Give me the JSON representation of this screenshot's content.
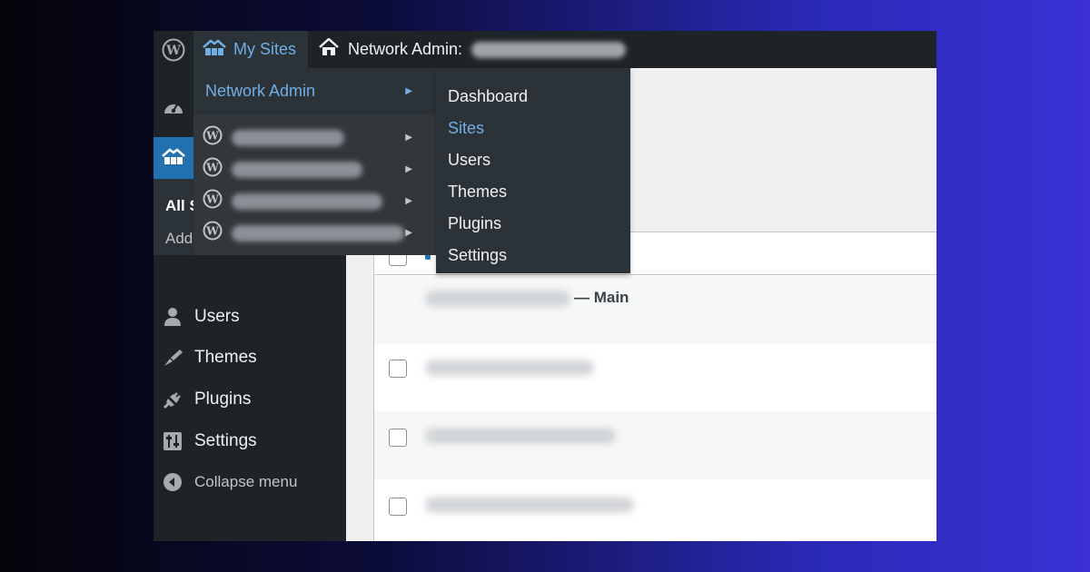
{
  "adminbar": {
    "my_sites_label": "My Sites",
    "network_admin_label": "Network Admin:"
  },
  "sidebar": {
    "submenu": [
      "All S",
      "Add"
    ],
    "items": [
      {
        "label": "Users",
        "icon": "user-icon"
      },
      {
        "label": "Themes",
        "icon": "brush-icon"
      },
      {
        "label": "Plugins",
        "icon": "plug-icon"
      },
      {
        "label": "Settings",
        "icon": "settings-icon"
      },
      {
        "label": "Collapse menu",
        "icon": "collapse-icon"
      }
    ]
  },
  "mysites_menu": {
    "network_admin": "Network Admin",
    "site_count": 4
  },
  "network_submenu": {
    "items": [
      "Dashboard",
      "Sites",
      "Users",
      "Themes",
      "Plugins",
      "Settings"
    ],
    "active": "Sites"
  },
  "table": {
    "main_suffix": "— Main"
  },
  "colors": {
    "adminbar": "#1d2327",
    "submenu": "#2c3338",
    "highlight": "#2271b1",
    "link": "#72aee6"
  }
}
